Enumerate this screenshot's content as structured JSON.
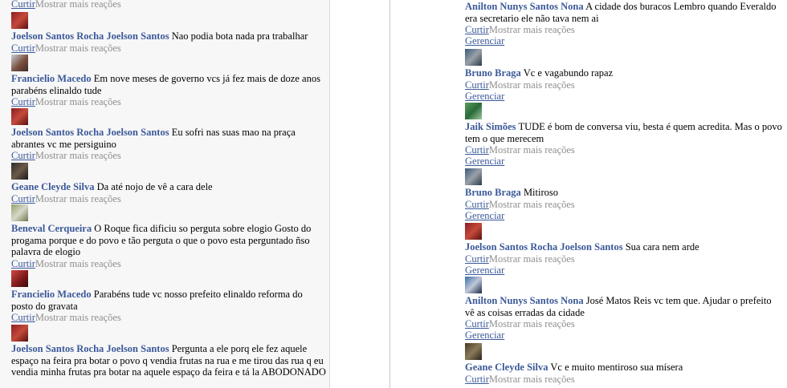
{
  "actions": {
    "like": "Curtir",
    "more_reactions": "Mostrar mais reações",
    "manage": "Gerenciar"
  },
  "left_column": {
    "top_partial": {
      "like": "Curtir",
      "more": "Mostrar mais reações"
    },
    "comments": [
      {
        "author": "Joelson Santos Rocha Joelson Santos",
        "text": "Nao podia bota nada pra trabalhar"
      },
      {
        "author": "Francielio Macedo",
        "text": "Em nove meses de governo vcs já fez mais de doze anos parabéns elinaldo tude"
      },
      {
        "author": "Joelson Santos Rocha Joelson Santos",
        "text": "Eu sofri nas suas mao na praça abrantes vc me persiguino"
      },
      {
        "author": "Geane Cleyde Silva",
        "text": "Da até nojo de vê a cara dele"
      },
      {
        "author": "Beneval Cerqueira",
        "text": "O Roque fica dificiu so perguta sobre elogio Gosto do progama porque e do povo e tão perguta o que o povo esta perguntado ñso palavra de elogio"
      },
      {
        "author": "Francielio Macedo",
        "text": "Parabéns tude vc nosso prefeito elinaldo reforma do posto do gravata"
      },
      {
        "author": "Joelson Santos Rocha Joelson Santos",
        "text": "Pergunta a ele porq ele fez aquele espaço na feira pra botar o povo q vendia frutas na rua e me tirou das rua q eu vendia minha frutas pra botar na aquele espaço da feira e tá la ABODONADO"
      }
    ]
  },
  "right_column": {
    "comments": [
      {
        "author": "Anilton Nunys Santos Nona",
        "text": "A cidade dos buracos Lembro quando Everaldo era secretario ele não tava nem ai"
      },
      {
        "author": "Bruno Braga",
        "text": "Vc e vagabundo rapaz"
      },
      {
        "author": "Jaik Simões",
        "text": "TUDE é bom de conversa viu, besta é quem acredita. Mas o povo tem o que merecem"
      },
      {
        "author": "Bruno Braga",
        "text": "Mitiroso"
      },
      {
        "author": "Joelson Santos Rocha Joelson Santos",
        "text": "Sua cara nem arde"
      },
      {
        "author": "Anilton Nunys Santos Nona",
        "text": "José Matos Reis vc tem que. Ajudar o prefeito vê as coisas erradas da cidade"
      },
      {
        "author": "Geane Cleyde Silva",
        "text": "Vc e muito mentiroso sua mísera"
      }
    ]
  }
}
